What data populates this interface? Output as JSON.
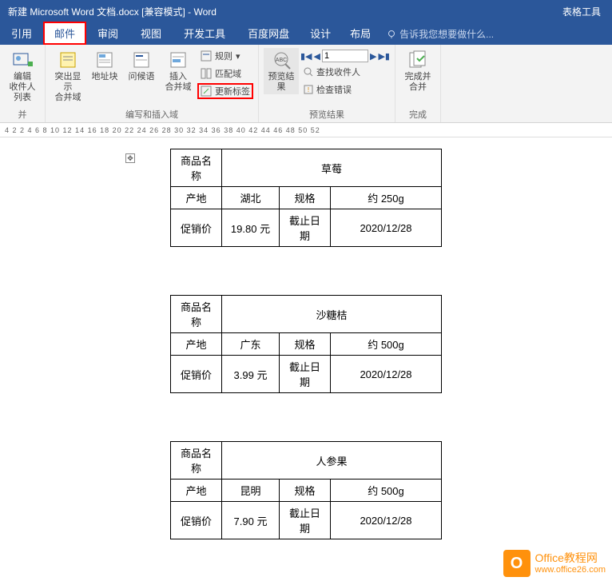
{
  "title": "新建 Microsoft Word 文档.docx [兼容模式] - Word",
  "tools_tab": "表格工具",
  "tabs": {
    "yinyong": "引用",
    "youjian": "邮件",
    "shenyue": "审阅",
    "shitu": "视图",
    "kaifa": "开发工具",
    "baidu": "百度网盘",
    "sheji": "设计",
    "buju": "布局"
  },
  "tellme": "告诉我您想要做什么...",
  "ribbon": {
    "edit_recipients": "编辑\n收件人列表",
    "highlight_merge": "突出显示\n合并域",
    "address_block": "地址块",
    "greeting": "问候语",
    "insert_merge": "插入\n合并域",
    "rules": "规则",
    "match_fields": "匹配域",
    "update_labels": "更新标签",
    "preview_results": "预览结果",
    "find_recipient": "查找收件人",
    "check_errors": "检查错误",
    "record_value": "1",
    "finish_merge": "完成并合并",
    "group_write": "编写和插入域",
    "group_preview": "预览结果",
    "group_finish": "完成"
  },
  "ruler_text": "4  2    2  4  6  8 10 12 14 16 18 20 22 24 26 28 30 32 34 36 38 40 42 44 46 48 50 52",
  "labels": {
    "name": "商品名称",
    "origin": "产地",
    "spec": "规格",
    "price": "促销价",
    "deadline": "截止日期"
  },
  "tables": [
    {
      "name": "草莓",
      "origin": "湖北",
      "spec": "约 250g",
      "price": "19.80 元",
      "deadline": "2020/12/28"
    },
    {
      "name": "沙糖桔",
      "origin": "广东",
      "spec": "约 500g",
      "price": "3.99 元",
      "deadline": "2020/12/28"
    },
    {
      "name": "人参果",
      "origin": "昆明",
      "spec": "约 500g",
      "price": "7.90 元",
      "deadline": "2020/12/28"
    }
  ],
  "watermark": {
    "brand": "Office教程网",
    "url": "www.office26.com"
  }
}
